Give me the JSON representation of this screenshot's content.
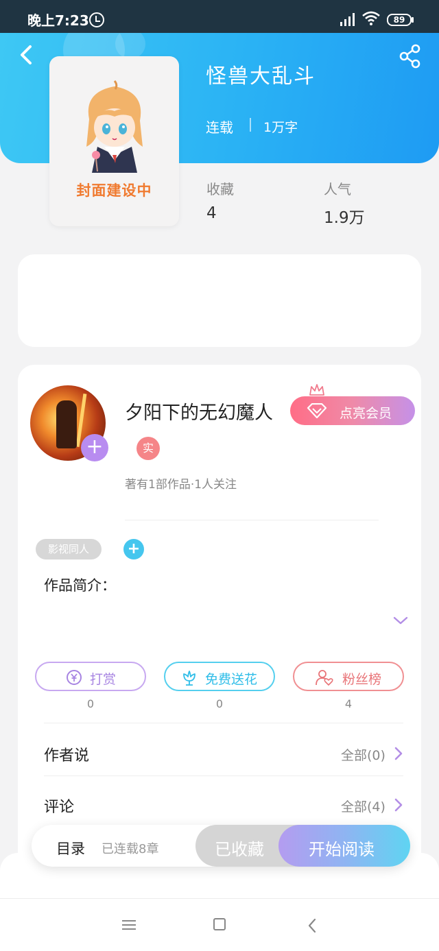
{
  "status_bar": {
    "time": "晚上7:23",
    "battery": "89"
  },
  "book": {
    "title": "怪兽大乱斗",
    "status": "连载",
    "word_count": "1万字",
    "cover_text": "封面建设中",
    "stats": [
      {
        "label": "收藏",
        "value": "4"
      },
      {
        "label": "人气",
        "value": "1.9万"
      }
    ]
  },
  "author": {
    "name": "夕阳下的无幻魔人",
    "vip_button": "点亮会员",
    "badge": "实",
    "meta": "著有1部作品·1人关注"
  },
  "tags": [
    "影视同人"
  ],
  "intro_label": "作品简介：",
  "actions": [
    {
      "label": "打赏",
      "count": "0",
      "color": "#b994e8"
    },
    {
      "label": "免费送花",
      "count": "0",
      "color": "#4cc8ec"
    },
    {
      "label": "粉丝榜",
      "count": "4",
      "color": "#ef8383"
    }
  ],
  "sections": [
    {
      "label": "作者说",
      "more": "全部(0)"
    },
    {
      "label": "评论",
      "more": "全部(4)"
    }
  ],
  "bottom_bar": {
    "catalog": "目录",
    "catalog_sub": "已连载8章",
    "collected": "已收藏",
    "read": "开始阅读"
  },
  "colors": {
    "accent": "#2ab2f4",
    "purple": "#b88cf0"
  }
}
